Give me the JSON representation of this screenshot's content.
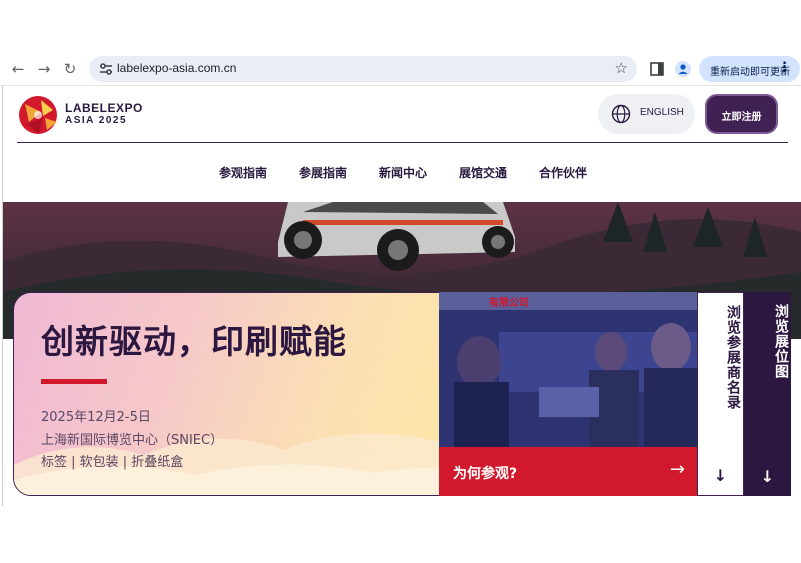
{
  "browser": {
    "url": "labelexpo-asia.com.cn",
    "update_label": "重新启动即可更新"
  },
  "site": {
    "logo": {
      "line1": "LABELEXPO",
      "line2": "ASIA 2025"
    },
    "language_label": "ENGLISH",
    "register_label": "立即注册",
    "nav": [
      "参观指南",
      "参展指南",
      "新闻中心",
      "展馆交通",
      "合作伙伴"
    ]
  },
  "hero": {
    "title": "创新驱动，印刷赋能",
    "date": "2025年12月2-5日",
    "venue": "上海新国际博览中心（SNIEC）",
    "categories": "标签 | 软包装 | 折叠纸盒",
    "why_visit_label": "为何参观?",
    "photo_sign_text": "有限公司",
    "exhibitor_list_label": "浏览参展商名录",
    "floor_plan_label": "浏览展位图"
  },
  "colors": {
    "brand_purple": "#3f2154",
    "brand_red": "#d1182c",
    "omnibox": "#e9eef6",
    "update_pill": "#d3e3fd"
  },
  "icons": [
    "back-arrow-icon",
    "forward-arrow-icon",
    "reload-icon",
    "site-settings-icon",
    "bookmark-star-icon",
    "side-panel-icon",
    "profile-icon",
    "kebab-menu-icon",
    "globe-icon",
    "arrow-right-icon",
    "arrow-down-icon"
  ]
}
